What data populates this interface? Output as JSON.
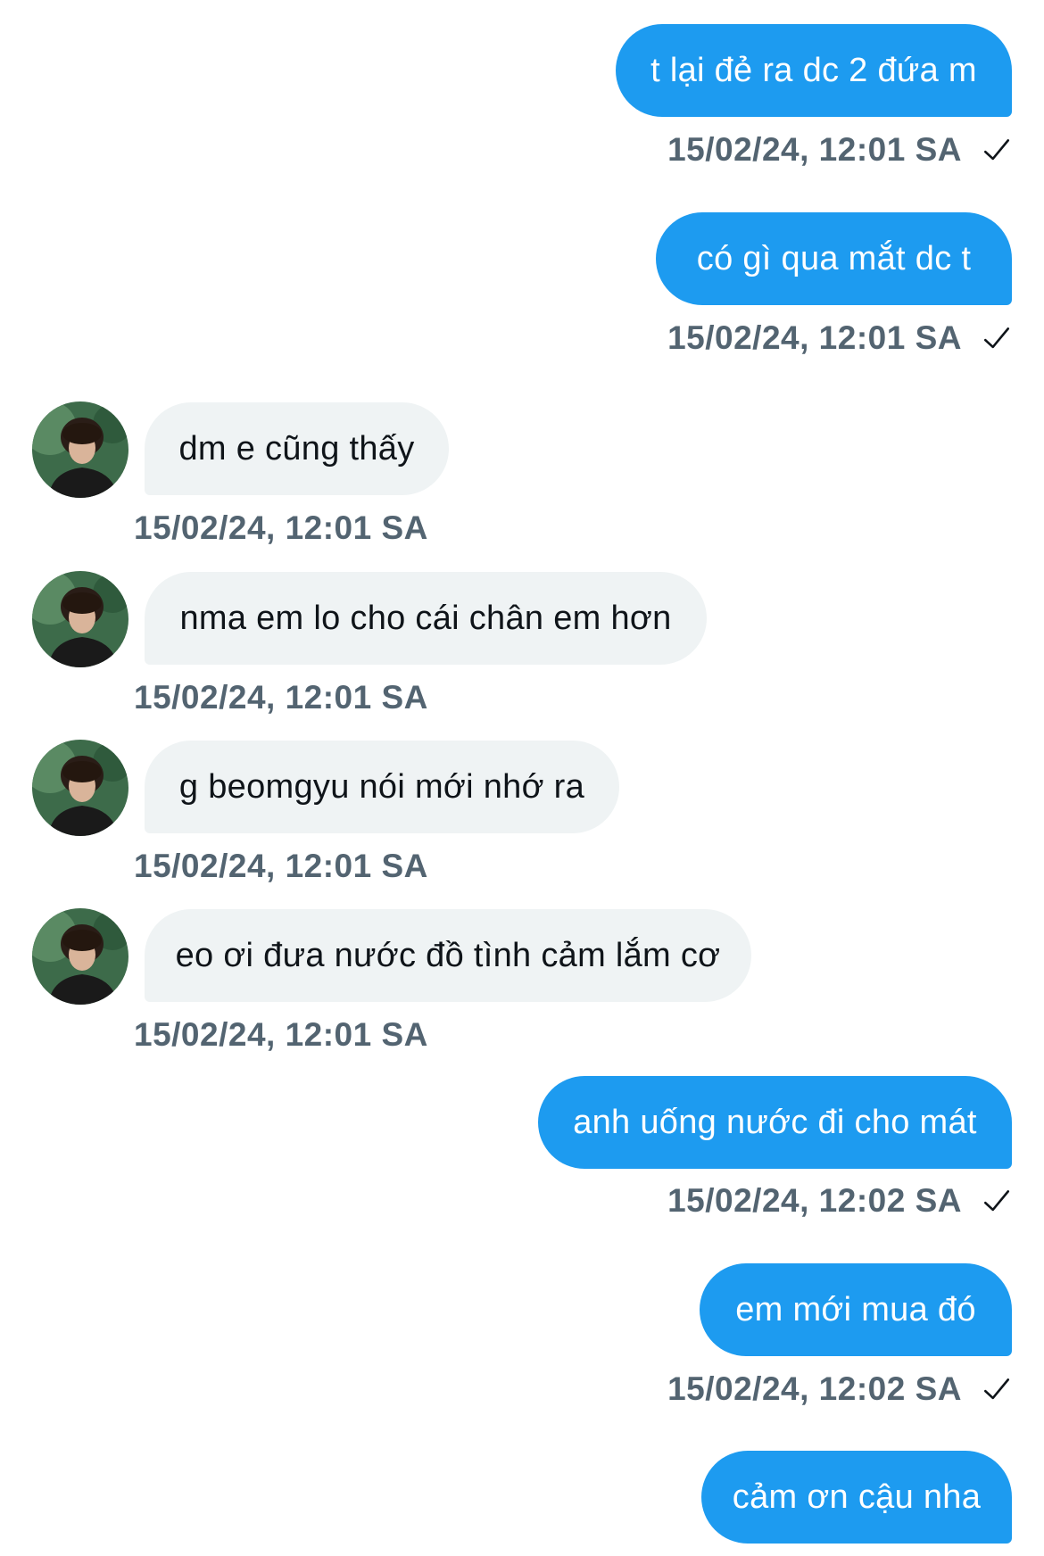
{
  "conversation": {
    "messages": [
      {
        "direction": "out",
        "text": "t lại đẻ ra dc 2 đứa m",
        "timestamp": "15/02/24, 12:01 SA",
        "status_icon": "checkmark-icon"
      },
      {
        "direction": "out",
        "text": "có gì qua mắt dc t",
        "timestamp": "15/02/24, 12:01 SA",
        "status_icon": "checkmark-icon"
      },
      {
        "direction": "in",
        "text": "dm e cũng thấy",
        "timestamp": "15/02/24, 12:01 SA",
        "avatar_icon": "avatar-icon"
      },
      {
        "direction": "in",
        "text": "nma em lo cho cái chân em hơn",
        "timestamp": "15/02/24, 12:01 SA",
        "avatar_icon": "avatar-icon"
      },
      {
        "direction": "in",
        "text": "g beomgyu nói mới nhớ ra",
        "timestamp": "15/02/24, 12:01 SA",
        "avatar_icon": "avatar-icon"
      },
      {
        "direction": "in",
        "text": "eo ơi đưa nước đồ tình cảm lắm cơ",
        "timestamp": "15/02/24, 12:01 SA",
        "avatar_icon": "avatar-icon"
      },
      {
        "direction": "out",
        "text": "anh uống nước đi cho mát",
        "timestamp": "15/02/24, 12:02 SA",
        "status_icon": "checkmark-icon"
      },
      {
        "direction": "out",
        "text": "em mới mua đó",
        "timestamp": "15/02/24, 12:02 SA",
        "status_icon": "checkmark-icon"
      },
      {
        "direction": "out",
        "text": "cảm ơn cậu nha",
        "timestamp": "",
        "status_icon": ""
      }
    ]
  },
  "colors": {
    "outgoing_bubble": "#1d9bf0",
    "incoming_bubble": "#eff3f4",
    "timestamp_text": "#536471",
    "background": "#ffffff"
  }
}
